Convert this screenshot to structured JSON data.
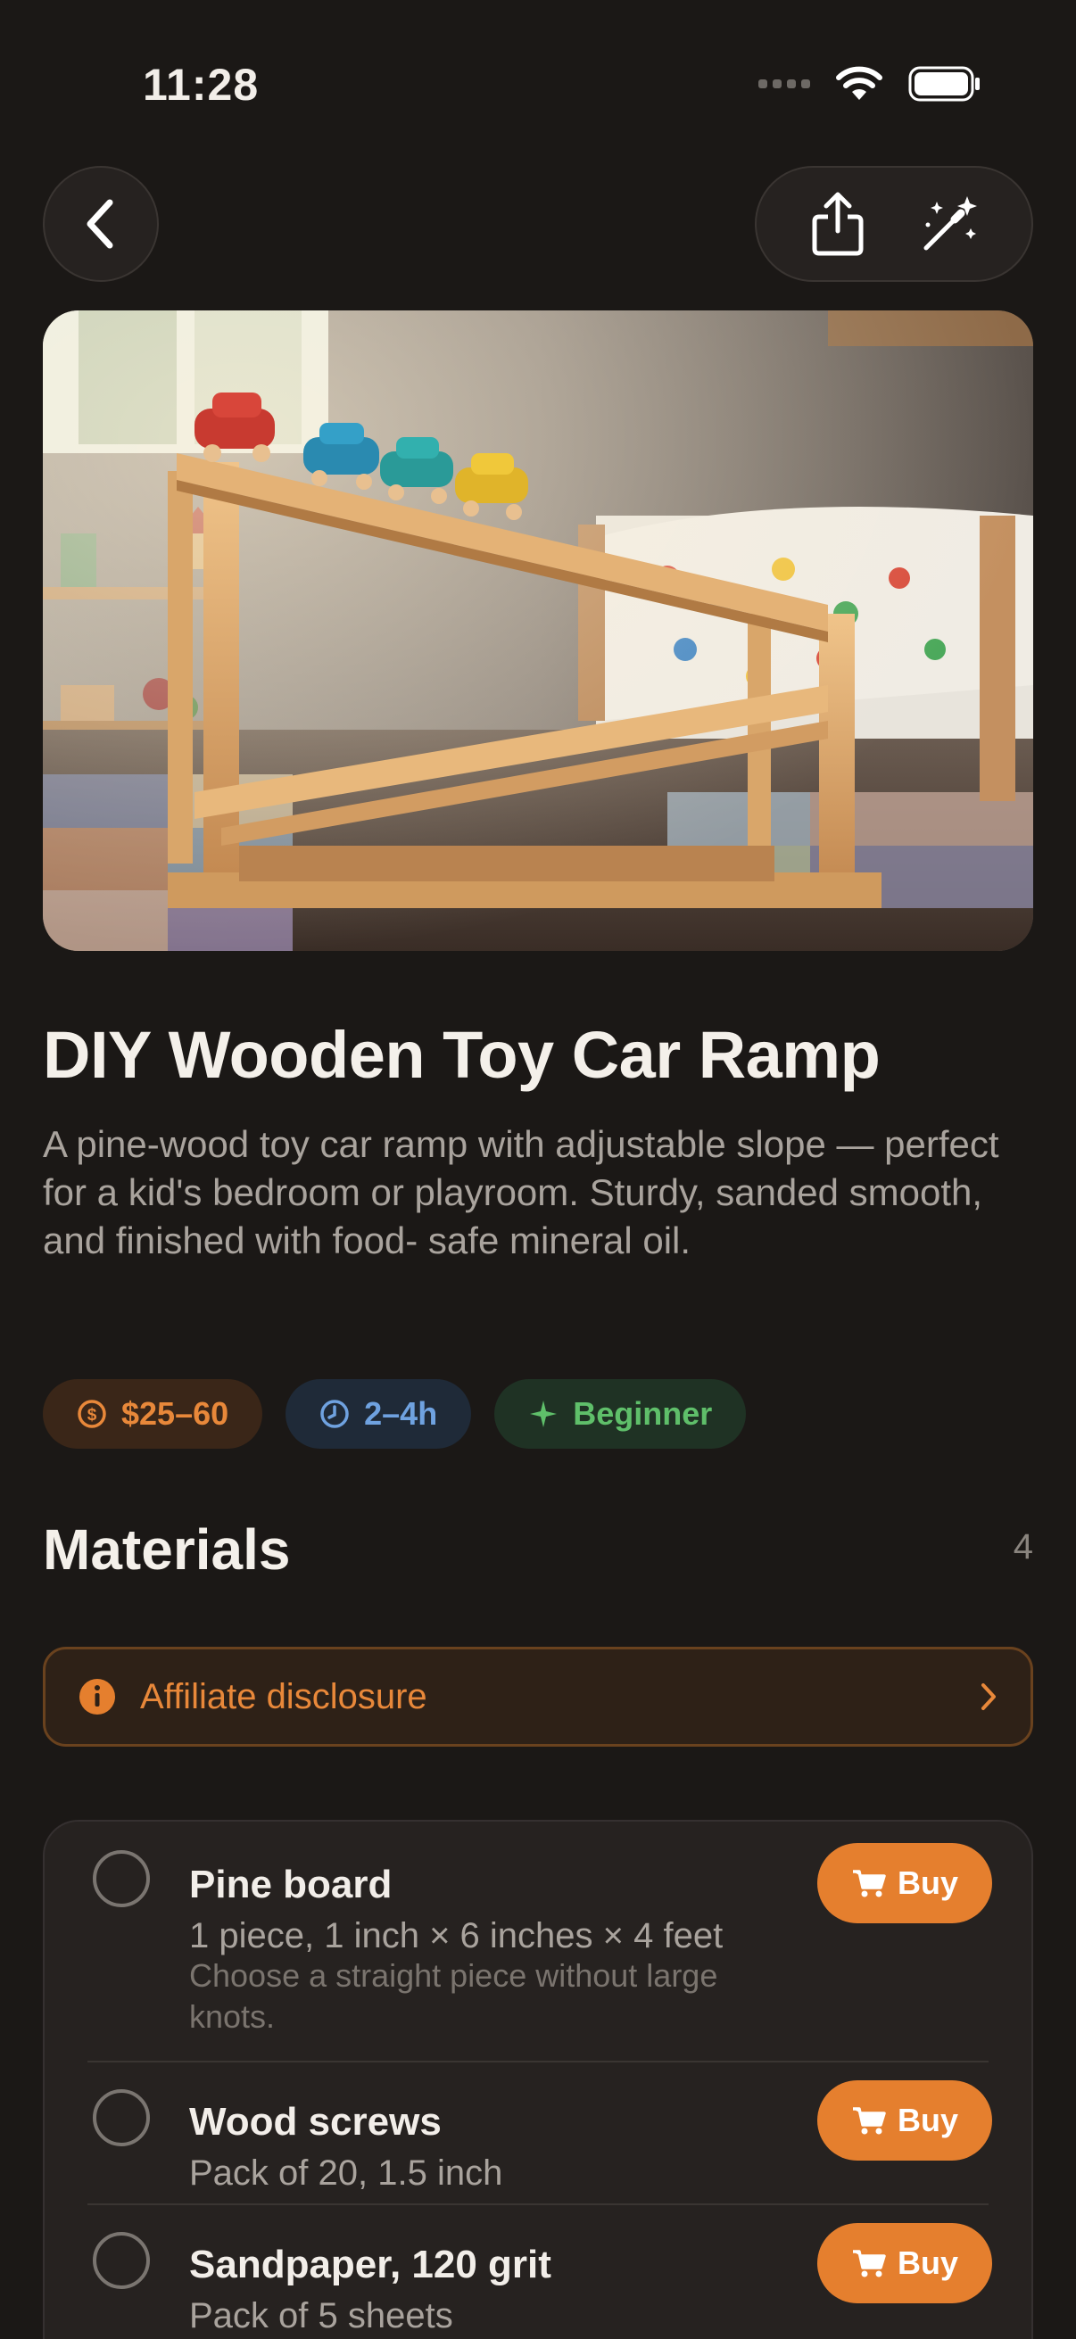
{
  "status": {
    "time": "11:28"
  },
  "project": {
    "title": "DIY Wooden Toy Car Ramp",
    "description": "A pine-wood toy car ramp with adjustable slope — perfect for a kid's bedroom or playroom. Sturdy, sanded smooth, and finished with food- safe mineral oil."
  },
  "chips": {
    "cost": "$25–60",
    "time": "2–4h",
    "level": "Beginner"
  },
  "materials": {
    "title": "Materials",
    "count": "4",
    "affiliate_label": "Affiliate disclosure",
    "buy_label": "Buy",
    "items": [
      {
        "name": "Pine board",
        "qty": "1 piece, 1 inch × 6 inches × 4 feet",
        "note": "Choose a straight piece without large knots."
      },
      {
        "name": "Wood screws",
        "qty": "Pack of 20, 1.5 inch"
      },
      {
        "name": "Sandpaper, 120 grit",
        "qty": "Pack of 5 sheets"
      }
    ]
  },
  "colors": {
    "accent": "#e57f2e",
    "background": "#1b1816",
    "cost_chip": "#e8883a",
    "time_chip": "#6fa2e0",
    "level_chip": "#5fbf6a"
  }
}
